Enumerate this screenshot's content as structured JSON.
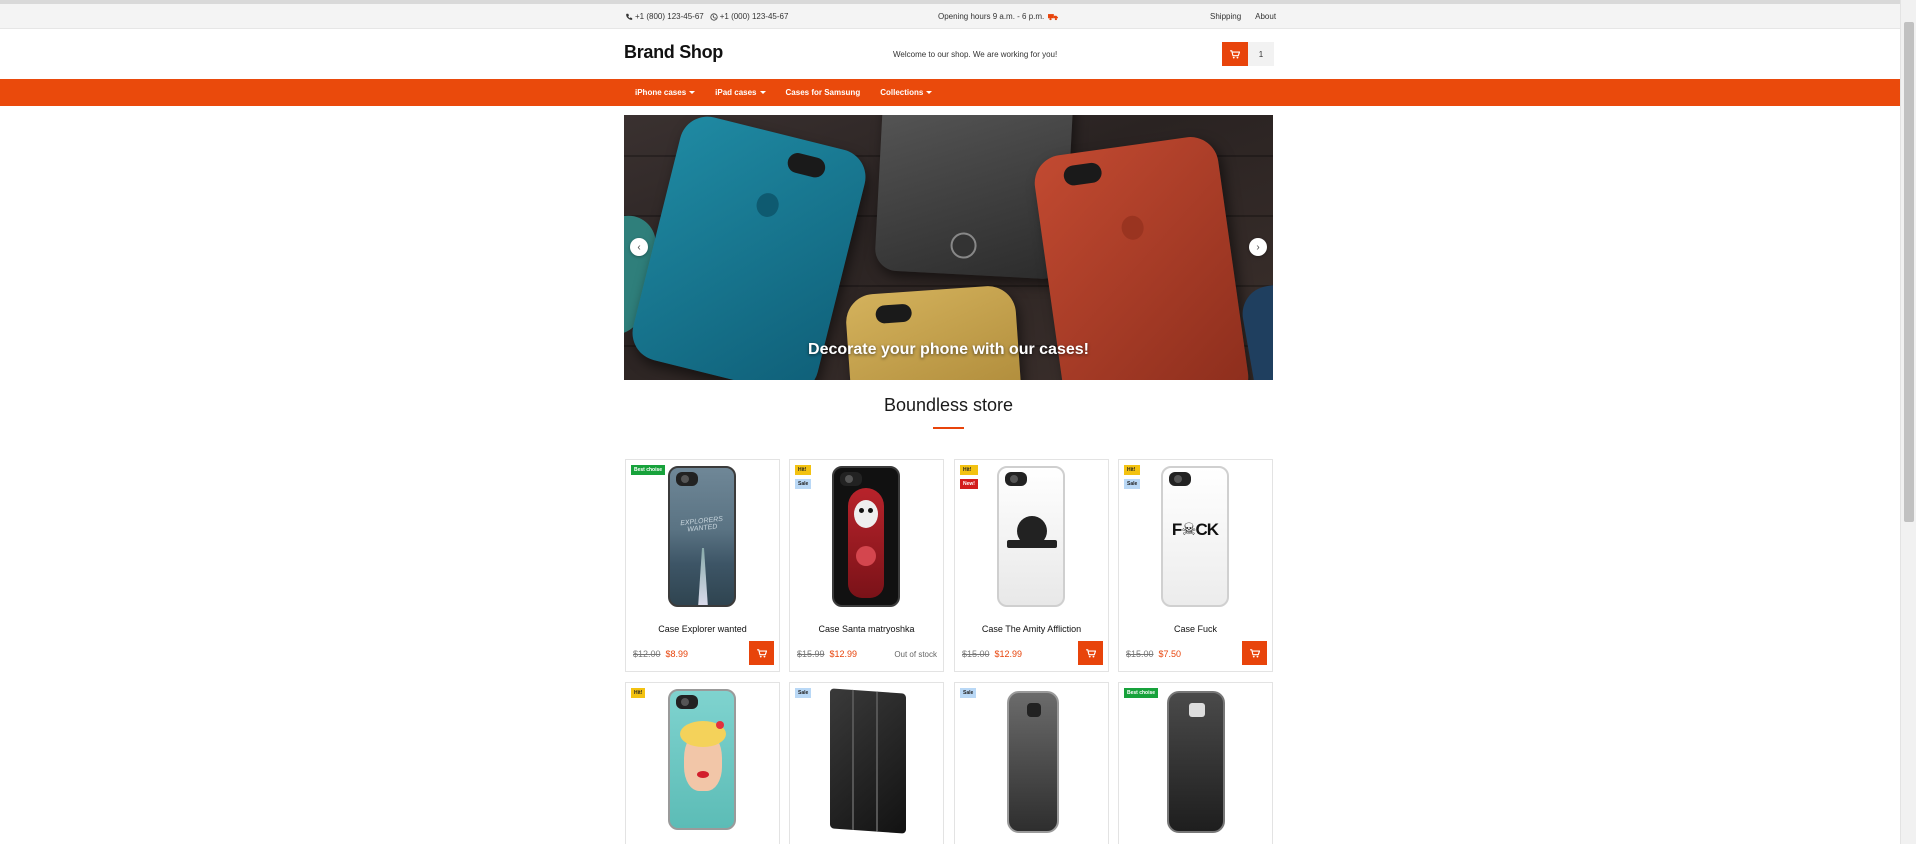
{
  "topbar": {
    "phone1": "+1 (800) 123-45-67",
    "phone2": "+1 (000) 123-45-67",
    "hours": "Opening hours 9 a.m. - 6 p.m.",
    "links": [
      "Shipping",
      "About"
    ]
  },
  "header": {
    "logo": "Brand Shop",
    "welcome": "Welcome to our shop. We are working for you!",
    "cart_count": "1"
  },
  "nav": {
    "items": [
      {
        "label": "iPhone cases",
        "dropdown": true
      },
      {
        "label": "iPad cases",
        "dropdown": true
      },
      {
        "label": "Cases for Samsung",
        "dropdown": false
      },
      {
        "label": "Collections",
        "dropdown": true
      }
    ]
  },
  "hero": {
    "caption": "Decorate your phone with our cases!",
    "prev": "‹",
    "next": "›"
  },
  "section": {
    "title": "Boundless store"
  },
  "products": [
    {
      "name": "Case Explorer wanted",
      "old_price": "$12.00",
      "price": "$8.99",
      "badges": [
        "Best choise"
      ],
      "stock": ""
    },
    {
      "name": "Case Santa matryoshka",
      "old_price": "$15.99",
      "price": "$12.99",
      "badges": [
        "Hit!",
        "Sale"
      ],
      "stock": "Out of stock"
    },
    {
      "name": "Case The Amity Affliction",
      "old_price": "$15.00",
      "price": "$12.99",
      "badges": [
        "Hit!",
        "New!"
      ],
      "stock": ""
    },
    {
      "name": "Case Fuck",
      "old_price": "$15.00",
      "price": "$7.50",
      "badges": [
        "Hit!",
        "Sale"
      ],
      "stock": ""
    },
    {
      "name": "",
      "old_price": "",
      "price": "",
      "badges": [
        "Hit!"
      ],
      "stock": ""
    },
    {
      "name": "",
      "old_price": "",
      "price": "",
      "badges": [
        "Sale"
      ],
      "stock": ""
    },
    {
      "name": "",
      "old_price": "",
      "price": "",
      "badges": [
        "Sale"
      ],
      "stock": ""
    },
    {
      "name": "",
      "old_price": "",
      "price": "",
      "badges": [
        "Best choise"
      ],
      "stock": ""
    }
  ],
  "product_art": {
    "case_0_text": "EXPLORERS WANTED",
    "case_3_text": "F☠CK"
  },
  "colors": {
    "accent": "#e8440b",
    "nav": "#ea4a0c",
    "badge_best": "#17a23b",
    "badge_hit": "#f3c211",
    "badge_sale": "#b9d8f6",
    "badge_new": "#d31d1d"
  }
}
